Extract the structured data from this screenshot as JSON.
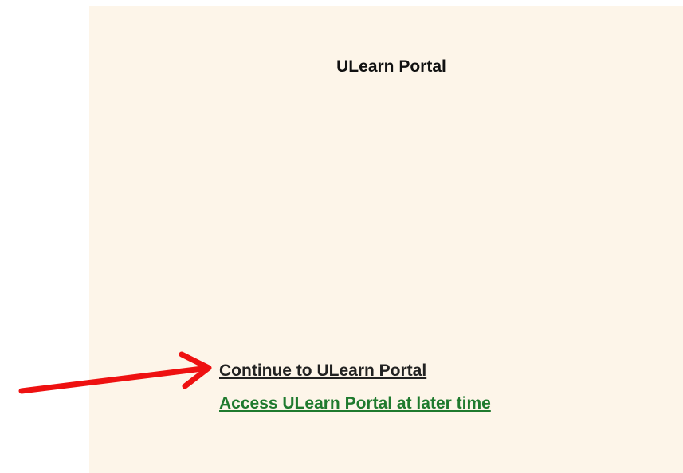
{
  "portal": {
    "title": "ULearn Portal",
    "background_color": "#fdf5e9"
  },
  "links": {
    "continue": {
      "label": "Continue to ULearn Portal",
      "color": "#222222"
    },
    "later": {
      "label": "Access ULearn Portal at later time",
      "color": "#1f7a2e"
    }
  },
  "annotation": {
    "icon": "red-arrow-icon",
    "color": "#ee1111"
  }
}
